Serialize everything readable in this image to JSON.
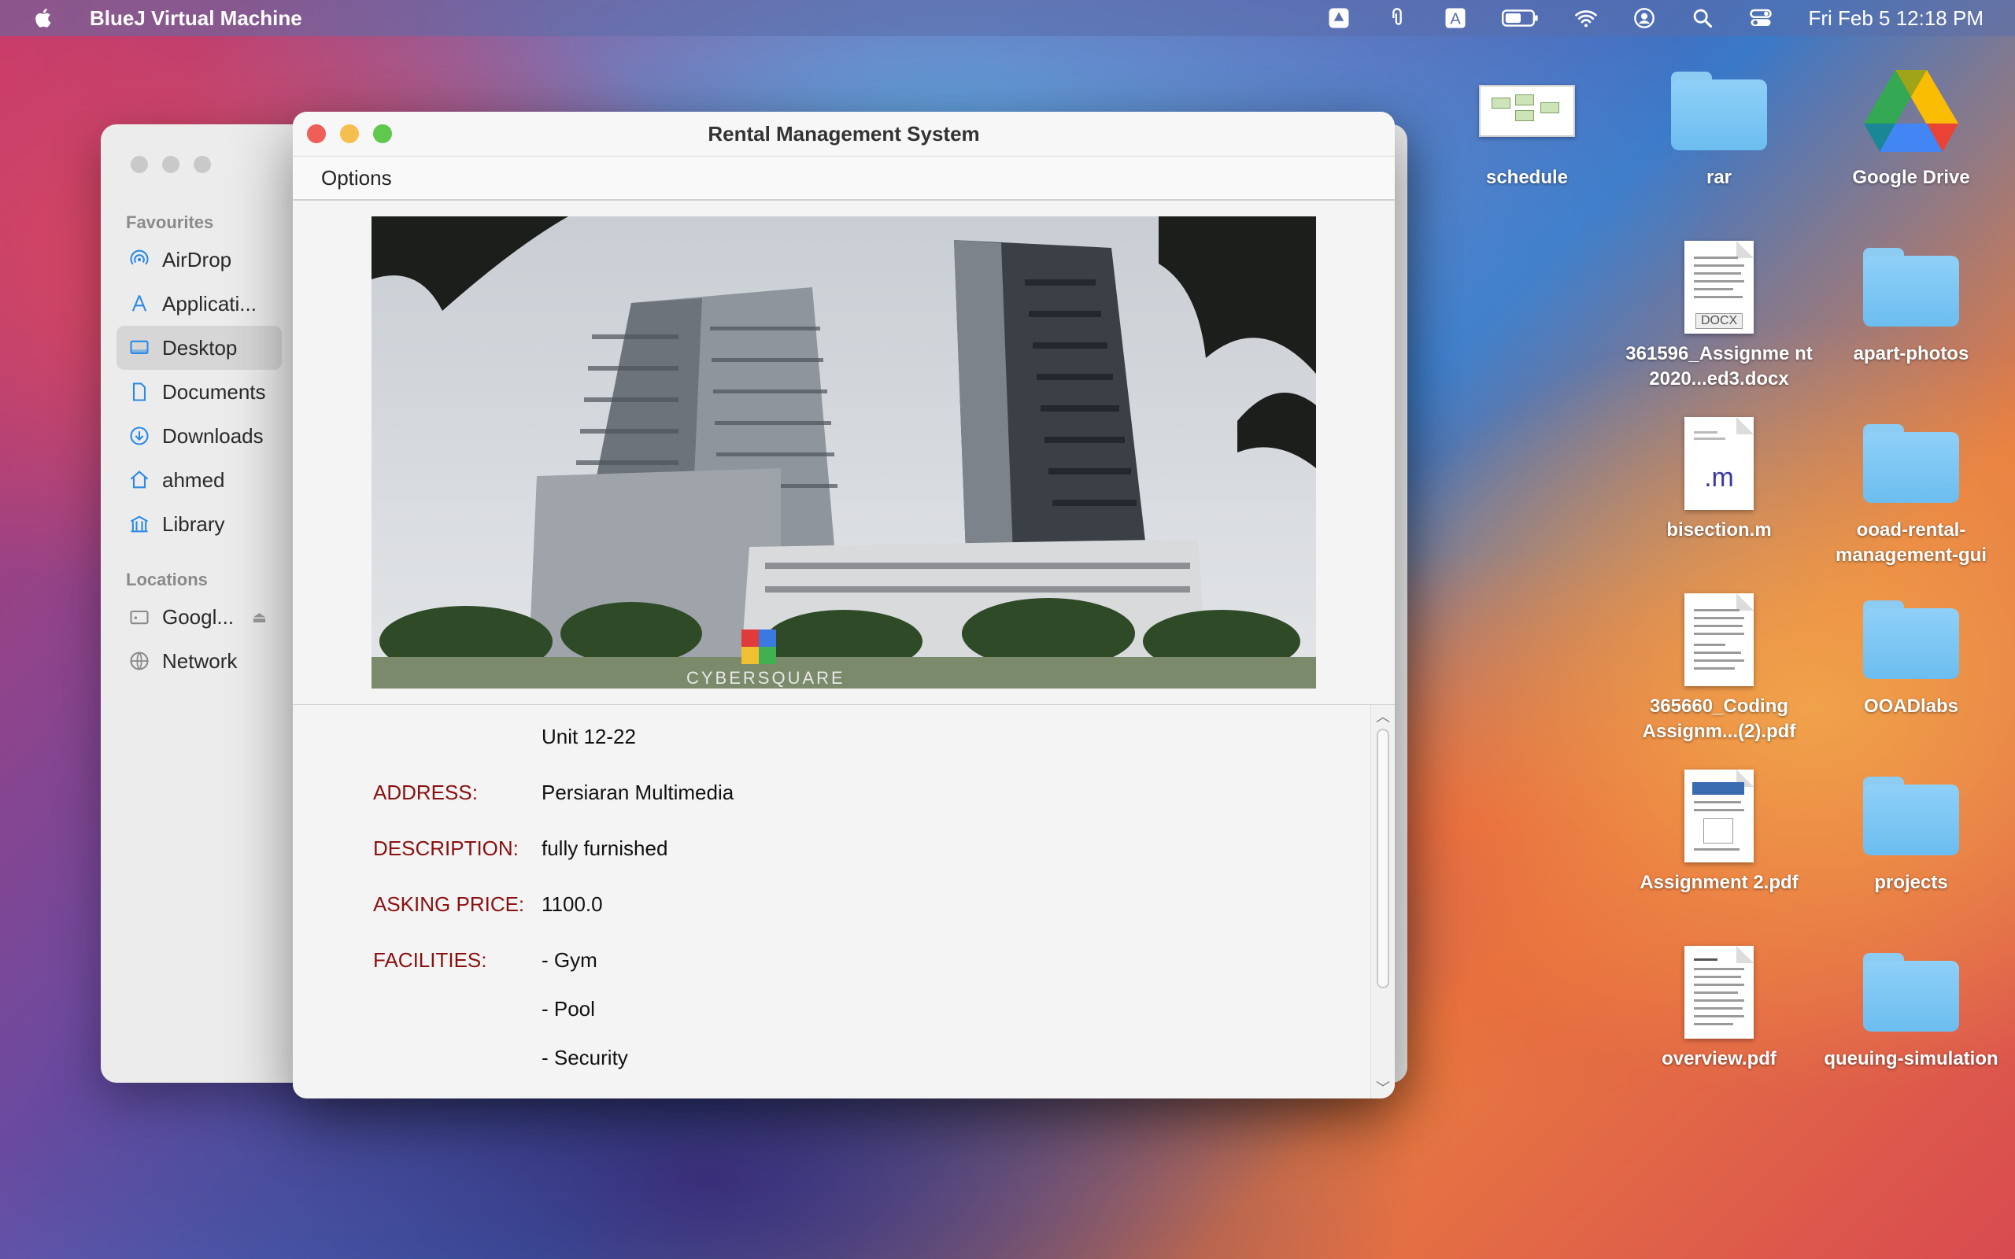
{
  "menubar": {
    "app_name": "BlueJ Virtual Machine",
    "clock": "Fri Feb 5  12:18 PM",
    "icons": [
      "apple-icon",
      "google-drive-status-icon",
      "paperclip-icon",
      "input-source-icon",
      "battery-icon",
      "wifi-icon",
      "user-icon",
      "search-icon",
      "control-center-icon"
    ]
  },
  "finder": {
    "favourites_heading": "Favourites",
    "favourites": [
      {
        "label": "AirDrop",
        "icon": "airdrop-icon"
      },
      {
        "label": "Applicati...",
        "icon": "applications-icon"
      },
      {
        "label": "Desktop",
        "icon": "desktop-icon"
      },
      {
        "label": "Documents",
        "icon": "document-icon"
      },
      {
        "label": "Downloads",
        "icon": "downloads-icon"
      },
      {
        "label": "ahmed",
        "icon": "home-icon"
      },
      {
        "label": "Library",
        "icon": "library-icon"
      }
    ],
    "locations_heading": "Locations",
    "locations": [
      {
        "label": "Googl...",
        "icon": "drive-icon"
      },
      {
        "label": "Network",
        "icon": "network-icon"
      }
    ],
    "selected": "Desktop"
  },
  "window": {
    "title": "Rental Management System",
    "menu_options": "Options",
    "photo_caption": "CYBERSQUARE"
  },
  "details": {
    "unit": "Unit 12-22",
    "address_label": "ADDRESS:",
    "address": "Persiaran Multimedia",
    "description_label": "DESCRIPTION:",
    "description": "fully furnished",
    "price_label": "ASKING PRICE:",
    "price": "1100.0",
    "facilities_label": "FACILITIES:",
    "facilities": [
      "- Gym",
      "- Pool",
      "- Security"
    ]
  },
  "desktop": {
    "icons": [
      {
        "label": "schedule",
        "type": "image"
      },
      {
        "label": "rar",
        "type": "folder"
      },
      {
        "label": "Google Drive",
        "type": "drive"
      },
      {
        "label": "361596_Assignme nt 2020...ed3.docx",
        "type": "docx",
        "badge": "DOCX"
      },
      {
        "label": "apart-photos",
        "type": "folder"
      },
      {
        "label": "bisection.m",
        "type": "m-file",
        "badge": ".m"
      },
      {
        "label": "ooad-rental-management-gui",
        "type": "folder"
      },
      {
        "label": "365660_Coding Assignm...(2).pdf",
        "type": "pdf"
      },
      {
        "label": "OOADlabs",
        "type": "folder"
      },
      {
        "label": "Assignment 2.pdf",
        "type": "pdf"
      },
      {
        "label": "projects",
        "type": "folder"
      },
      {
        "label": "overview.pdf",
        "type": "pdf"
      },
      {
        "label": "queuing-simulation",
        "type": "folder"
      }
    ]
  },
  "colors": {
    "label_red": "#8b1010",
    "close": "#ed5f57",
    "minimize": "#f5be4f",
    "zoom": "#5fc84d"
  }
}
